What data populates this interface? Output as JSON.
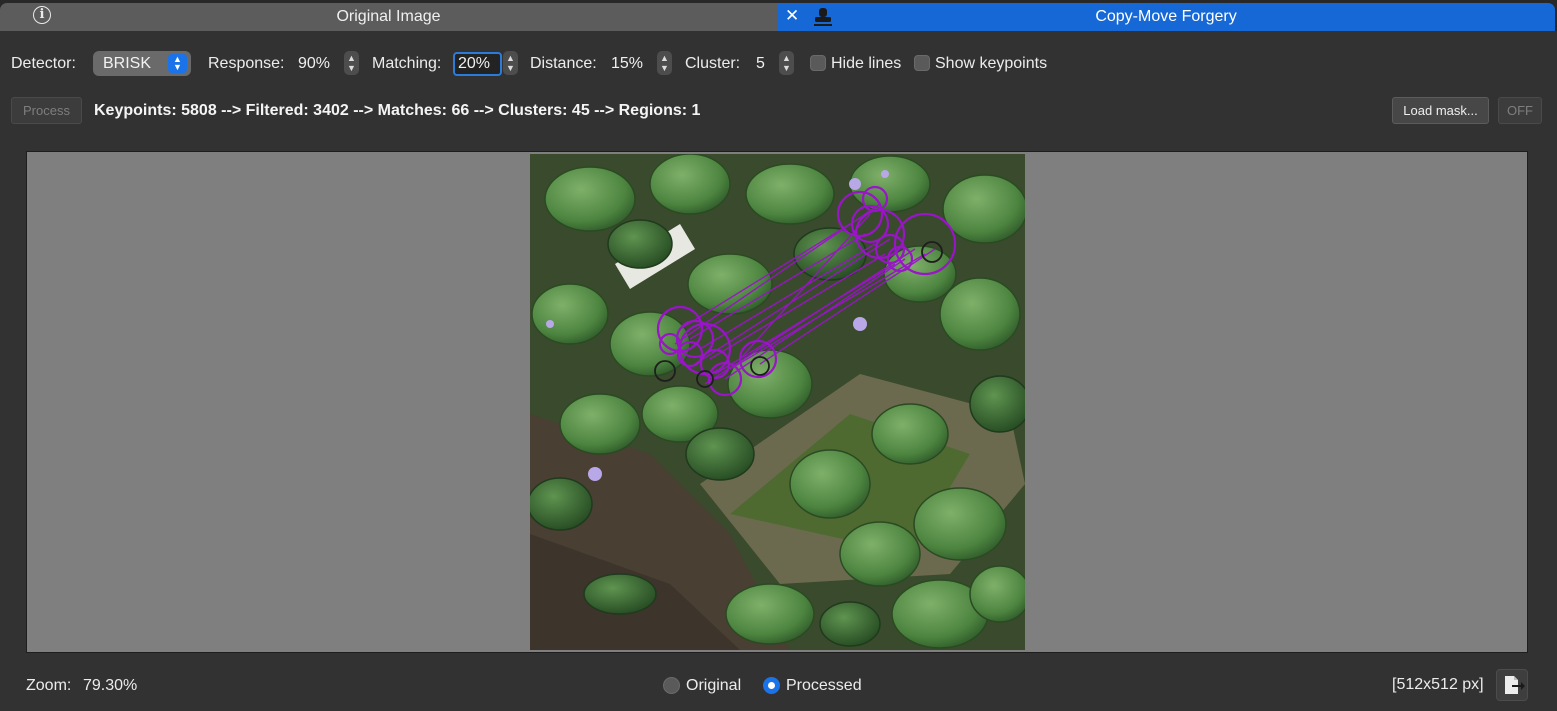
{
  "tabs": [
    {
      "label": "Original Image",
      "icon": "info-icon"
    },
    {
      "label": "Copy-Move Forgery",
      "icon": "stamp-icon",
      "active": true,
      "close_icon": "close-icon"
    }
  ],
  "toolbar": {
    "detector": {
      "label": "Detector:",
      "value": "BRISK"
    },
    "response": {
      "label": "Response:",
      "value": "90%"
    },
    "matching": {
      "label": "Matching:",
      "value": "20%"
    },
    "distance": {
      "label": "Distance:",
      "value": "15%"
    },
    "cluster": {
      "label": "Cluster:",
      "value": "5"
    },
    "hide_lines": {
      "label": "Hide lines",
      "checked": false
    },
    "show_keypoints": {
      "label": "Show keypoints",
      "checked": false
    },
    "process_label": "Process",
    "summary": "Keypoints: 5808 --> Filtered: 3402 --> Matches: 66 --> Clusters: 45 --> Regions: 1",
    "load_mask_label": "Load mask...",
    "off_label": "OFF"
  },
  "bottom": {
    "zoom_label": "Zoom:",
    "zoom_value": "79.30%",
    "radio_original": "Original",
    "radio_processed": "Processed",
    "selected_view": "Processed",
    "image_size": "[512x512 px]",
    "export_icon": "export-icon"
  },
  "colors": {
    "accent": "#1a73e8",
    "active_tab": "#1668d6",
    "match_overlay": "#9a14c8"
  }
}
